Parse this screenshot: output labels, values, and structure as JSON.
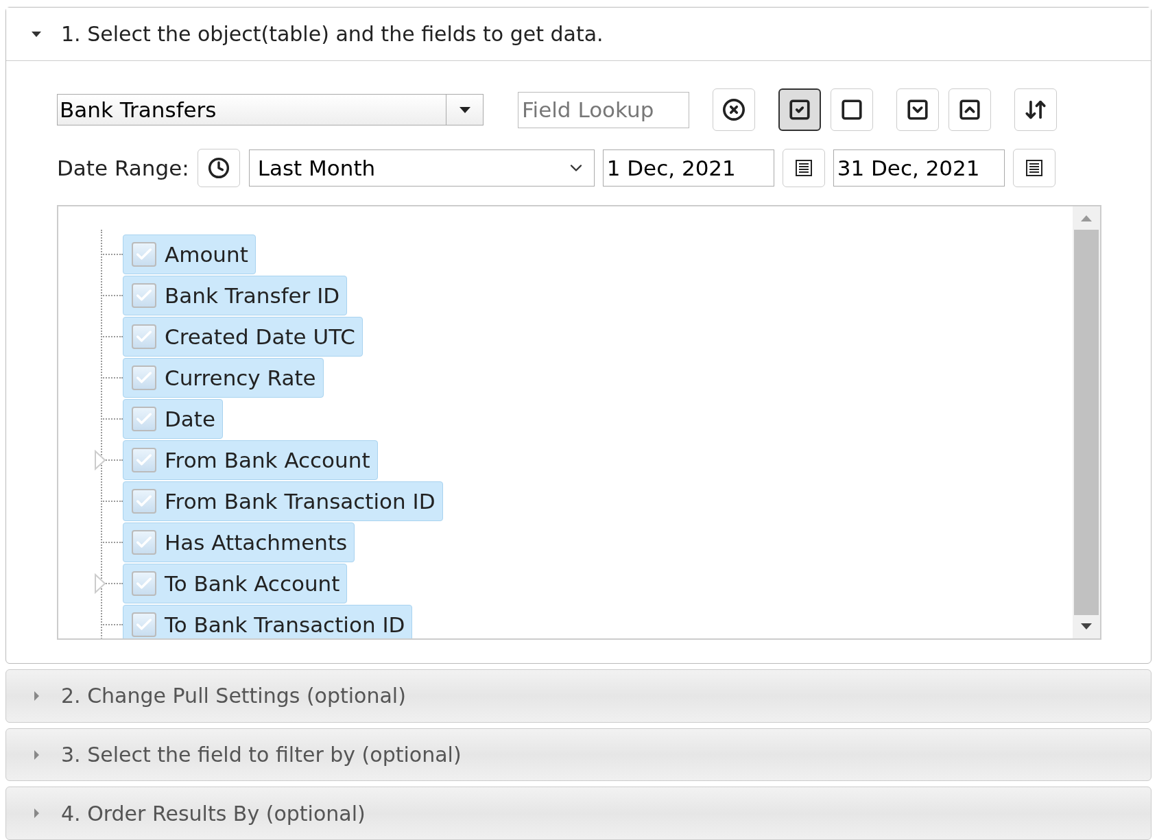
{
  "sections": [
    {
      "title": "1. Select the object(table) and the fields to get data.",
      "expanded": true
    },
    {
      "title": "2. Change Pull Settings (optional)",
      "expanded": false
    },
    {
      "title": "3. Select the field to filter by (optional)",
      "expanded": false
    },
    {
      "title": "4. Order Results By (optional)",
      "expanded": false
    }
  ],
  "object_select": {
    "value": "Bank Transfers"
  },
  "field_lookup": {
    "placeholder": "Field Lookup"
  },
  "toolbar": [
    {
      "kind": "clear",
      "pressed": false
    },
    {
      "kind": "check-all",
      "pressed": true
    },
    {
      "kind": "uncheck-all",
      "pressed": false
    },
    {
      "kind": "expand-all",
      "pressed": false
    },
    {
      "kind": "collapse-all",
      "pressed": false
    },
    {
      "kind": "sort",
      "pressed": false
    }
  ],
  "date_range": {
    "label": "Date Range:",
    "preset": "Last Month",
    "from": "1 Dec, 2021",
    "to": "31 Dec, 2021"
  },
  "fields": [
    {
      "label": "Amount",
      "checked": true,
      "selected": true,
      "expandable": false
    },
    {
      "label": "Bank Transfer ID",
      "checked": true,
      "selected": true,
      "expandable": false
    },
    {
      "label": "Created Date UTC",
      "checked": true,
      "selected": true,
      "expandable": false
    },
    {
      "label": "Currency Rate",
      "checked": true,
      "selected": true,
      "expandable": false
    },
    {
      "label": "Date",
      "checked": true,
      "selected": true,
      "expandable": false
    },
    {
      "label": "From Bank Account",
      "checked": true,
      "selected": true,
      "expandable": true
    },
    {
      "label": "From Bank Transaction ID",
      "checked": true,
      "selected": true,
      "expandable": false
    },
    {
      "label": "Has Attachments",
      "checked": true,
      "selected": true,
      "expandable": false
    },
    {
      "label": "To Bank Account",
      "checked": true,
      "selected": true,
      "expandable": true
    },
    {
      "label": "To Bank Transaction ID",
      "checked": true,
      "selected": true,
      "expandable": false
    }
  ]
}
